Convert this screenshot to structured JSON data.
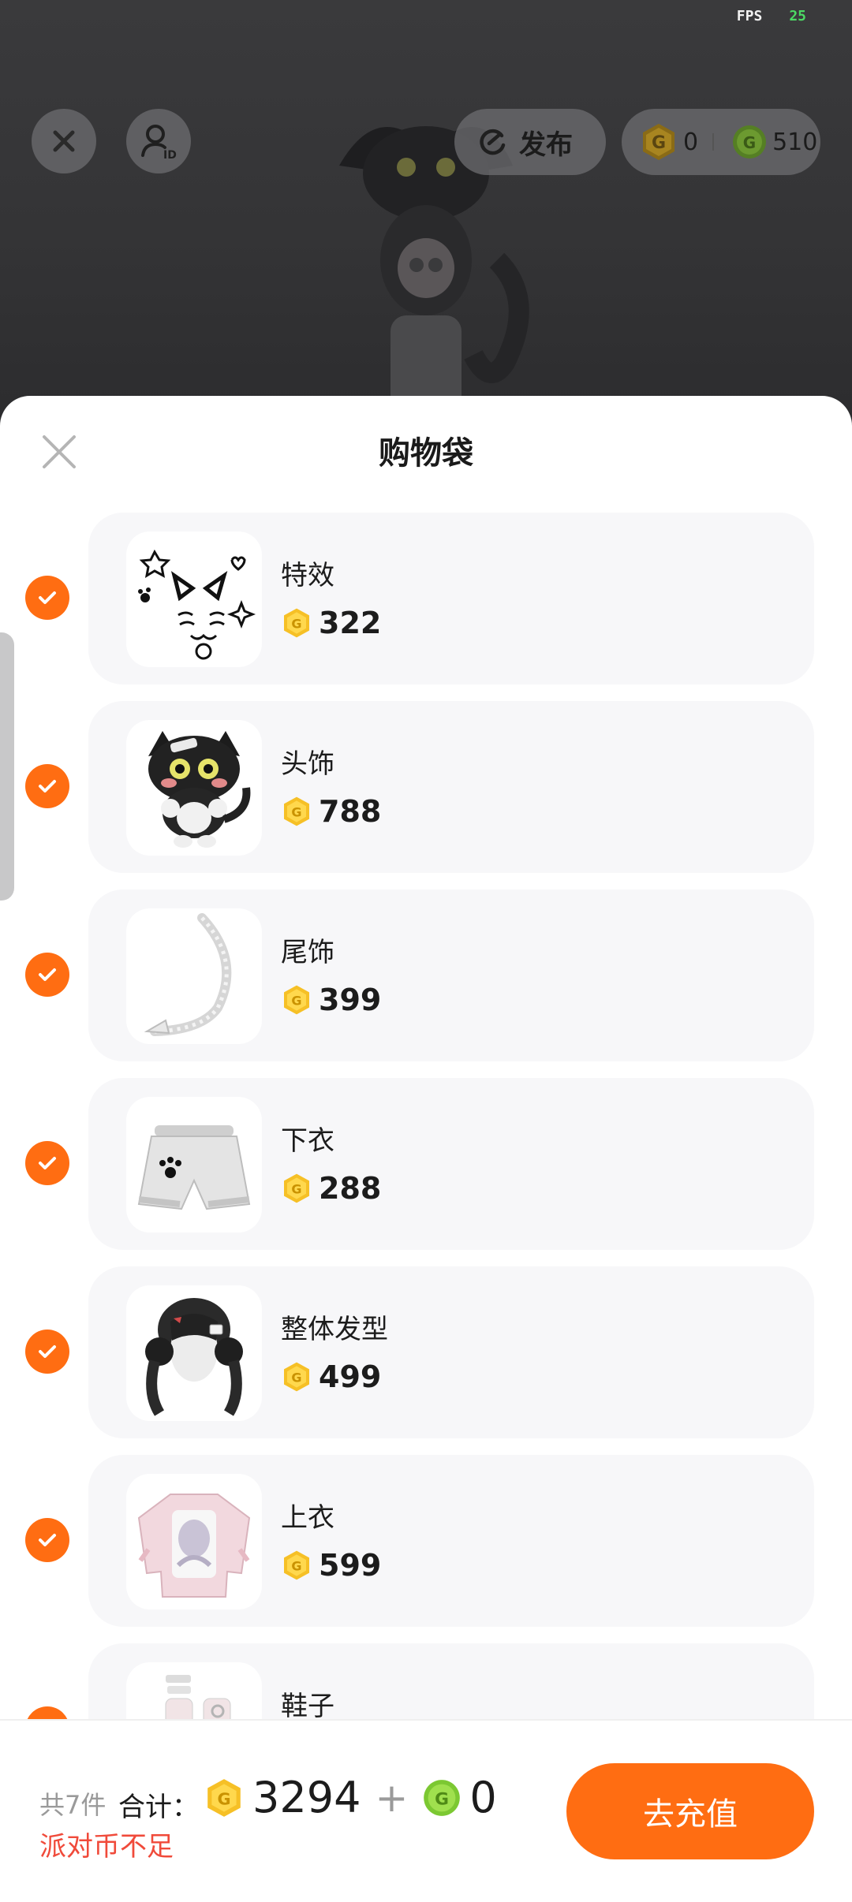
{
  "hud": {
    "fps_label": "FPS",
    "fps_value": "25",
    "publish_label": "发布",
    "party_coin_balance": "0",
    "green_coin_balance": "510"
  },
  "sheet": {
    "title": "购物袋"
  },
  "items": [
    {
      "name": "特效",
      "price": "322",
      "checked": true
    },
    {
      "name": "头饰",
      "price": "788",
      "checked": true
    },
    {
      "name": "尾饰",
      "price": "399",
      "checked": true
    },
    {
      "name": "下衣",
      "price": "288",
      "checked": true
    },
    {
      "name": "整体发型",
      "price": "499",
      "checked": true
    },
    {
      "name": "上衣",
      "price": "599",
      "checked": true
    },
    {
      "name": "鞋子",
      "price": "",
      "checked": true
    }
  ],
  "footer": {
    "count_text": "共7件",
    "total_label": "合计：",
    "total_party_coin": "3294",
    "plus": "+",
    "total_green_coin": "0",
    "warning": "派对币不足",
    "recharge_label": "去充值"
  },
  "colors": {
    "accent_orange": "#ff6d12",
    "coin_gold": "#f6c026",
    "coin_green": "#7cc832",
    "warning_red": "#f04a3a"
  },
  "icons": {
    "close": "close-icon",
    "user_id": "user-id-icon",
    "publish": "publish-refresh-icon",
    "party_coin": "gold-coin-icon",
    "green_coin": "green-coin-icon",
    "check": "checkmark-icon"
  }
}
